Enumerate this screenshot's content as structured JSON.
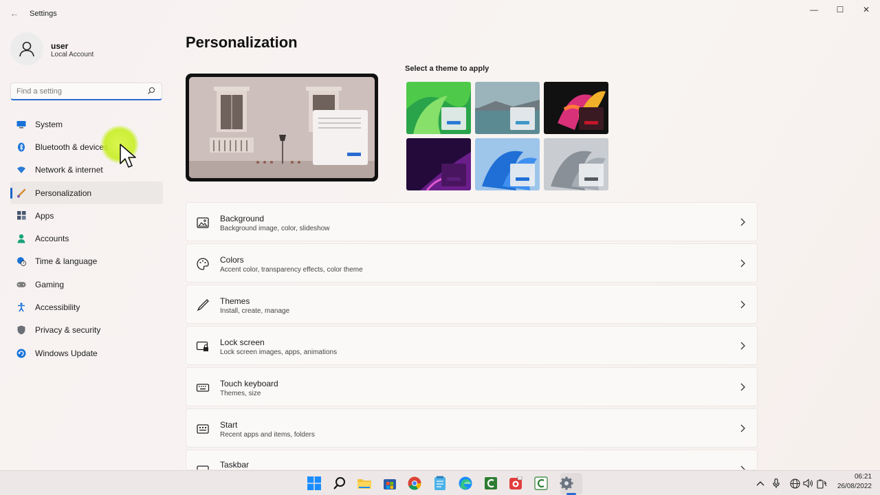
{
  "window": {
    "app_title": "Settings",
    "controls": {
      "minimize": "—",
      "maximize": "☐",
      "close": "✕"
    }
  },
  "user": {
    "name": "user",
    "account_type": "Local Account"
  },
  "search": {
    "placeholder": "Find a setting"
  },
  "sidebar": {
    "items": [
      {
        "label": "System",
        "icon": "monitor-icon",
        "color": "#0f6fc6"
      },
      {
        "label": "Bluetooth & devices",
        "icon": "bluetooth-icon",
        "color": "#1a73d9"
      },
      {
        "label": "Network & internet",
        "icon": "wifi-icon",
        "color": "#2b7bd6"
      },
      {
        "label": "Personalization",
        "icon": "brush-icon",
        "color": "#d58a2a",
        "active": true
      },
      {
        "label": "Apps",
        "icon": "apps-icon",
        "color": "#44546a"
      },
      {
        "label": "Accounts",
        "icon": "person-icon",
        "color": "#1aa37a"
      },
      {
        "label": "Time & language",
        "icon": "globe-clock-icon",
        "color": "#1a73d9"
      },
      {
        "label": "Gaming",
        "icon": "gamepad-icon",
        "color": "#7a7a7a"
      },
      {
        "label": "Accessibility",
        "icon": "accessibility-icon",
        "color": "#1a73d9"
      },
      {
        "label": "Privacy & security",
        "icon": "shield-icon",
        "color": "#6b6f78"
      },
      {
        "label": "Windows Update",
        "icon": "update-icon",
        "color": "#1a73d9"
      }
    ]
  },
  "main": {
    "title": "Personalization",
    "theme_heading": "Select a theme to apply",
    "themes": [
      {
        "name": "theme-green",
        "accent": "#2a7bd6"
      },
      {
        "name": "theme-lake",
        "accent": "#3f97c9"
      },
      {
        "name": "theme-flower",
        "accent": "#c3162a"
      },
      {
        "name": "theme-purple-glow",
        "accent": "#5b1f7a"
      },
      {
        "name": "theme-blue-bloom",
        "accent": "#1f6fd6"
      },
      {
        "name": "theme-grey-bloom",
        "accent": "#555a60"
      }
    ],
    "cards": [
      {
        "title": "Background",
        "subtitle": "Background image, color, slideshow",
        "icon": "image-icon"
      },
      {
        "title": "Colors",
        "subtitle": "Accent color, transparency effects, color theme",
        "icon": "palette-icon"
      },
      {
        "title": "Themes",
        "subtitle": "Install, create, manage",
        "icon": "pen-icon"
      },
      {
        "title": "Lock screen",
        "subtitle": "Lock screen images, apps, animations",
        "icon": "lock-screen-icon"
      },
      {
        "title": "Touch keyboard",
        "subtitle": "Themes, size",
        "icon": "keyboard-icon"
      },
      {
        "title": "Start",
        "subtitle": "Recent apps and items, folders",
        "icon": "start-icon"
      },
      {
        "title": "Taskbar",
        "subtitle": "",
        "icon": "taskbar-icon"
      }
    ]
  },
  "taskbar": {
    "apps": [
      "windows-start-icon",
      "search-icon",
      "file-explorer-icon",
      "store-icon",
      "chrome-icon",
      "notepad-icon",
      "edge-icon",
      "camtasia-icon",
      "recorder-icon",
      "editor-icon",
      "settings-icon"
    ],
    "clock": {
      "time": "06:21",
      "date": "26/08/2022"
    }
  }
}
